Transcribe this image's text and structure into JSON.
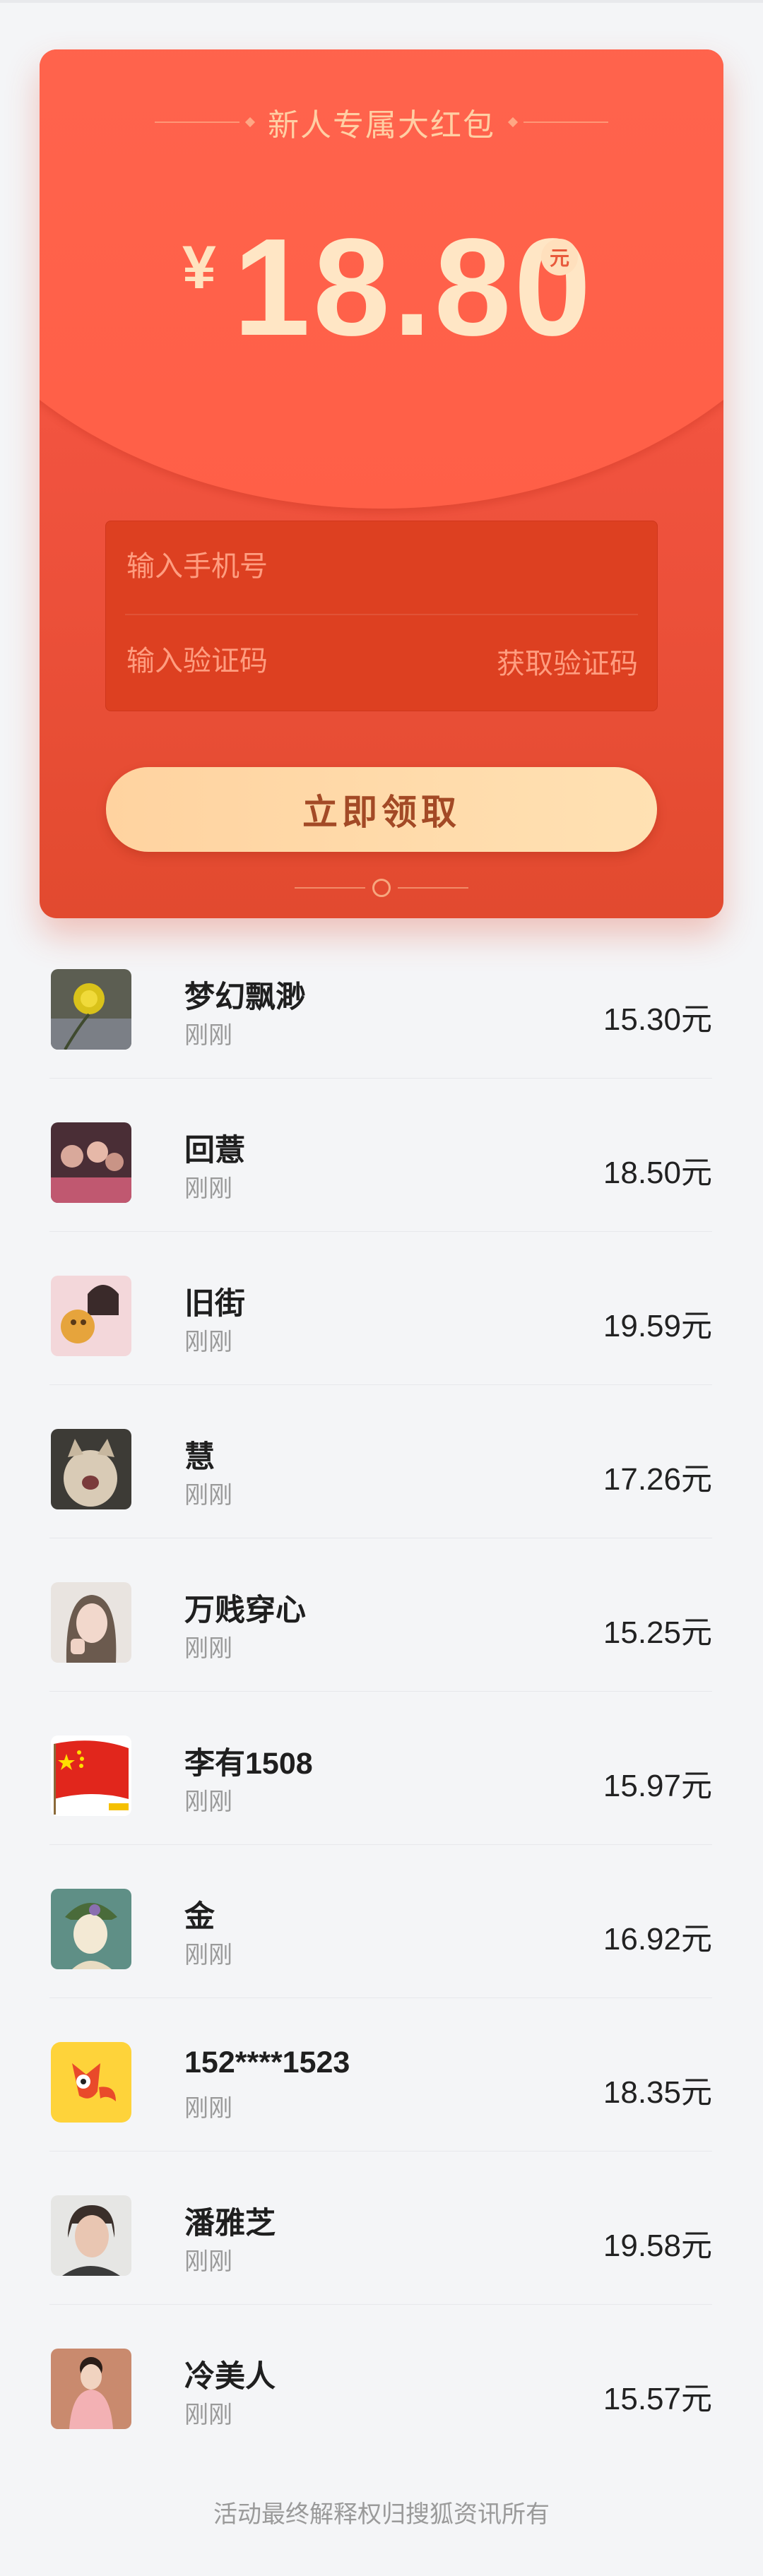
{
  "card": {
    "banner_title": "新人专属大红包",
    "currency_symbol": "¥",
    "amount": "18.80",
    "unit": "元",
    "phone_placeholder": "输入手机号",
    "code_placeholder": "输入验证码",
    "get_code_label": "获取验证码",
    "claim_label": "立即领取"
  },
  "list": [
    {
      "name": "梦幻飘渺",
      "time": "刚刚",
      "amount": "15.30元",
      "avatar_icon": "dandelion-avatar"
    },
    {
      "name": "回薏",
      "time": "刚刚",
      "amount": "18.50元",
      "avatar_icon": "group-photo-avatar"
    },
    {
      "name": "旧街",
      "time": "刚刚",
      "amount": "19.59元",
      "avatar_icon": "girl-with-bear-avatar"
    },
    {
      "name": "慧",
      "time": "刚刚",
      "amount": "17.26元",
      "avatar_icon": "cat-avatar"
    },
    {
      "name": "万贱穿心",
      "time": "刚刚",
      "amount": "15.25元",
      "avatar_icon": "girl-portrait-avatar"
    },
    {
      "name": "李有1508",
      "time": "刚刚",
      "amount": "15.97元",
      "avatar_icon": "china-flag-avatar"
    },
    {
      "name": "金",
      "time": "刚刚",
      "amount": "16.92元",
      "avatar_icon": "anime-boy-avatar"
    },
    {
      "name": "152****1523",
      "time": "刚刚",
      "amount": "18.35元",
      "avatar_icon": "fox-logo-avatar"
    },
    {
      "name": "潘雅芝",
      "time": "刚刚",
      "amount": "19.58元",
      "avatar_icon": "woman-portrait-avatar"
    },
    {
      "name": "冷美人",
      "time": "刚刚",
      "amount": "15.57元",
      "avatar_icon": "woman-pink-dress-avatar"
    }
  ],
  "footer": "活动最终解释权归搜狐资讯所有"
}
